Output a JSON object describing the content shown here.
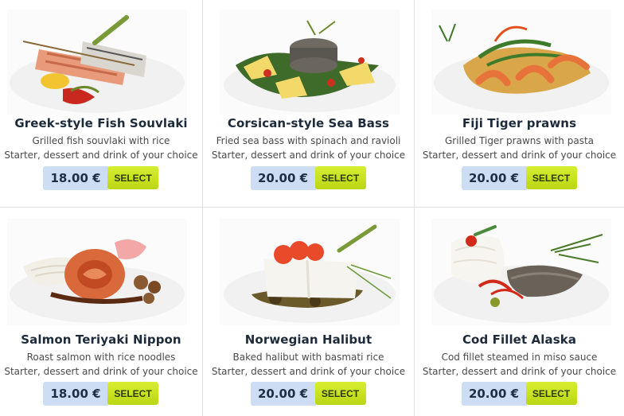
{
  "currency_select_label": "SELECT",
  "dishes": [
    {
      "title": "Greek-style Fish Souvlaki",
      "description": "Grilled fish souvlaki with rice",
      "extra": "Starter, dessert and drink of your choice",
      "price": "18.00 €",
      "select_label": "SELECT"
    },
    {
      "title": "Corsican-style Sea Bass",
      "description": "Fried sea bass with spinach and ravioli",
      "extra": "Starter, dessert and drink of your choice",
      "price": "20.00 €",
      "select_label": "SELECT"
    },
    {
      "title": "Fiji Tiger prawns",
      "description": "Grilled Tiger prawns with pasta",
      "extra": "Starter, dessert and drink of your choice",
      "price": "20.00 €",
      "select_label": "SELECT"
    },
    {
      "title": "Salmon Teriyaki Nippon",
      "description": "Roast salmon with rice noodles",
      "extra": "Starter, dessert and drink of your choice",
      "price": "18.00 €",
      "select_label": "SELECT"
    },
    {
      "title": "Norwegian Halibut",
      "description": "Baked halibut with basmati rice",
      "extra": "Starter, dessert and drink of your choice",
      "price": "20.00 €",
      "select_label": "SELECT"
    },
    {
      "title": "Cod Fillet Alaska",
      "description": "Cod fillet steamed in miso sauce",
      "extra": "Starter, dessert and drink of your choice",
      "price": "20.00 €",
      "select_label": "SELECT"
    }
  ],
  "colors": {
    "price_bg": "#cdddf4",
    "select_bg": "#c6e01e",
    "title": "#1c2a3a"
  }
}
